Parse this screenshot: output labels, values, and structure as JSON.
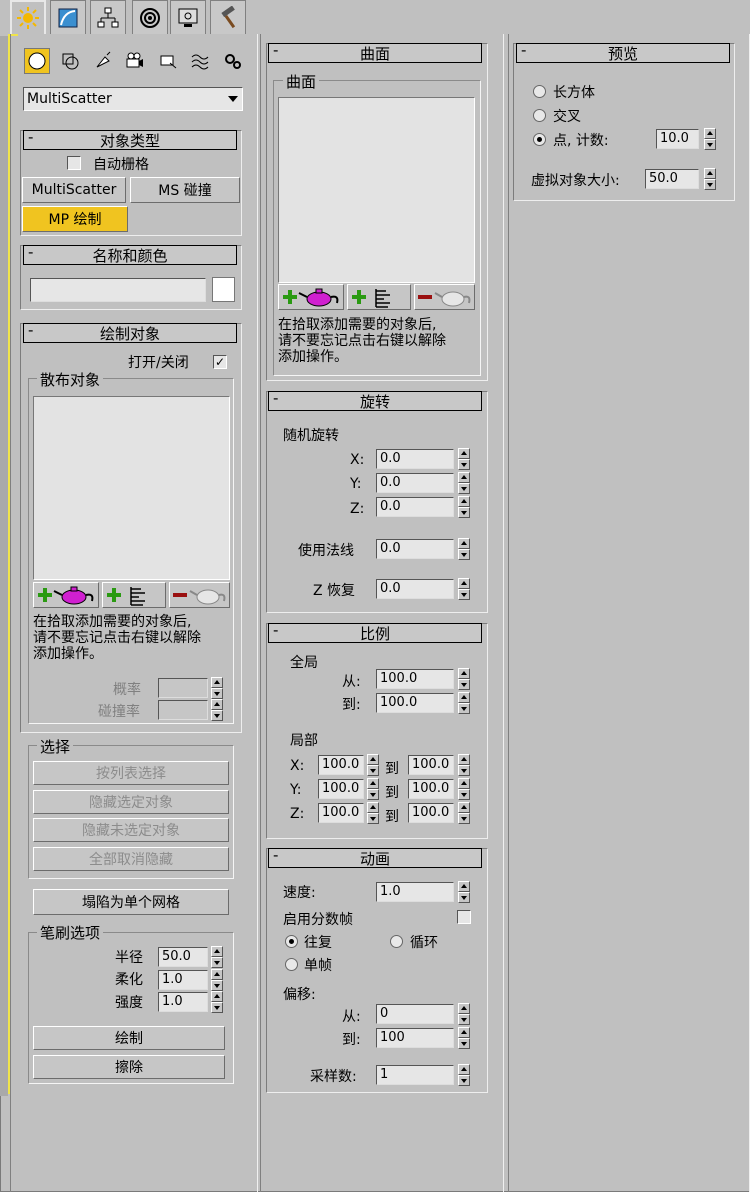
{
  "colors": {
    "highlight": "#f0c420",
    "frame_yellow": "#f0e44a"
  },
  "tabs": [
    {
      "icon": "create-icon"
    },
    {
      "icon": "modify-icon"
    },
    {
      "icon": "hierarchy-icon"
    },
    {
      "icon": "motion-icon"
    },
    {
      "icon": "display-icon"
    },
    {
      "icon": "utilities-icon"
    }
  ],
  "subcat_icons": [
    "geometry-icon",
    "shapes-icon",
    "lights-icon",
    "cameras-icon",
    "helpers-icon",
    "spacewarps-icon",
    "systems-icon"
  ],
  "category_dropdown": "MultiScatter",
  "object_type": {
    "title": "对象类型",
    "autogrid": "自动栅格",
    "buttons": [
      "MultiScatter",
      "MS 碰撞",
      "MP 绘制"
    ]
  },
  "name_color": {
    "title": "名称和颜色",
    "name_value": ""
  },
  "paint_objects": {
    "title": "绘制对象",
    "onoff": "打开/关闭",
    "scatter_group": "散布对象",
    "help": [
      "在拾取添加需要的对象后,",
      "请不要忘记点击右键以解除",
      "添加操作。"
    ],
    "prob": "概率",
    "collide": "碰撞率"
  },
  "selection": {
    "title": "选择",
    "buttons": [
      "按列表选择",
      "隐藏选定对象",
      "隐藏未选定对象",
      "全部取消隐藏"
    ]
  },
  "collapse": "塌陷为单个网格",
  "brush": {
    "title": "笔刷选项",
    "radius_label": "半径",
    "radius": "50.0",
    "soft_label": "柔化",
    "soft": "1.0",
    "strength_label": "强度",
    "strength": "1.0",
    "paint": "绘制",
    "erase": "擦除"
  },
  "surface": {
    "title": "曲面",
    "group": "曲面",
    "help": [
      "在拾取添加需要的对象后,",
      "请不要忘记点击右键以解除",
      "添加操作。"
    ]
  },
  "rotation": {
    "title": "旋转",
    "random": "随机旋转",
    "x_label": "X:",
    "x": "0.0",
    "y_label": "Y:",
    "y": "0.0",
    "z_label": "Z:",
    "z": "0.0",
    "normal_label": "使用法线",
    "normal": "0.0",
    "zrestore_label": "Z 恢复",
    "zrestore": "0.0"
  },
  "scale": {
    "title": "比例",
    "global": "全局",
    "from_label": "从:",
    "from": "100.0",
    "to_label": "到:",
    "to": "100.0",
    "local": "局部",
    "x_label": "X:",
    "x1": "100.0",
    "x2": "100.0",
    "y_label": "Y:",
    "y1": "100.0",
    "y2": "100.0",
    "z_label": "Z:",
    "z1": "100.0",
    "z2": "100.0",
    "to_short": "到"
  },
  "animation": {
    "title": "动画",
    "speed_label": "速度:",
    "speed": "1.0",
    "fraction_label": "启用分数帧",
    "pingpong": "往复",
    "loop": "循环",
    "single": "单帧",
    "offset": "偏移:",
    "from_label": "从:",
    "from": "0",
    "to_label": "到:",
    "to": "100",
    "samples_label": "采样数:",
    "samples": "1"
  },
  "preview": {
    "title": "预览",
    "box": "长方体",
    "cross": "交叉",
    "point": "点, 计数:",
    "point_count": "10.0",
    "dummy_label": "虚拟对象大小:",
    "dummy_size": "50.0"
  }
}
